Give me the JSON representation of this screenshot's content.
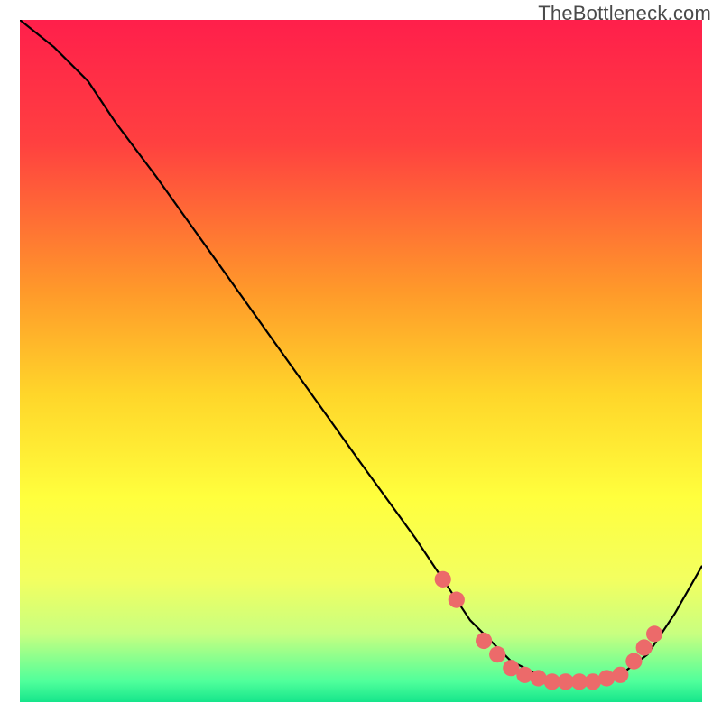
{
  "attribution": "TheBottleneck.com",
  "chart_data": {
    "type": "line",
    "title": "",
    "xlabel": "",
    "ylabel": "",
    "xlim": [
      0,
      100
    ],
    "ylim": [
      0,
      100
    ],
    "background_gradient": {
      "stops": [
        {
          "offset": 0,
          "color": "#ff1f4b"
        },
        {
          "offset": 18,
          "color": "#ff4040"
        },
        {
          "offset": 40,
          "color": "#ff9a2a"
        },
        {
          "offset": 55,
          "color": "#ffd62a"
        },
        {
          "offset": 70,
          "color": "#ffff3d"
        },
        {
          "offset": 82,
          "color": "#f3ff60"
        },
        {
          "offset": 90,
          "color": "#c8ff80"
        },
        {
          "offset": 97,
          "color": "#4fff9b"
        },
        {
          "offset": 100,
          "color": "#15e58b"
        }
      ]
    },
    "series": [
      {
        "name": "bottleneck-curve",
        "color": "#000000",
        "x": [
          0,
          5,
          10,
          14,
          20,
          30,
          40,
          50,
          58,
          62,
          66,
          72,
          78,
          84,
          88,
          92,
          96,
          100
        ],
        "y": [
          100,
          96,
          91,
          85,
          77,
          63,
          49,
          35,
          24,
          18,
          12,
          6,
          3,
          3,
          4,
          7,
          13,
          20
        ]
      }
    ],
    "markers": {
      "name": "highlighted-range",
      "color": "#ec6a6a",
      "radius_pct": 1.2,
      "points": [
        {
          "x": 62,
          "y": 18
        },
        {
          "x": 64,
          "y": 15
        },
        {
          "x": 68,
          "y": 9
        },
        {
          "x": 70,
          "y": 7
        },
        {
          "x": 72,
          "y": 5
        },
        {
          "x": 74,
          "y": 4
        },
        {
          "x": 76,
          "y": 3.5
        },
        {
          "x": 78,
          "y": 3
        },
        {
          "x": 80,
          "y": 3
        },
        {
          "x": 82,
          "y": 3
        },
        {
          "x": 84,
          "y": 3
        },
        {
          "x": 86,
          "y": 3.5
        },
        {
          "x": 88,
          "y": 4
        },
        {
          "x": 90,
          "y": 6
        },
        {
          "x": 91.5,
          "y": 8
        },
        {
          "x": 93,
          "y": 10
        }
      ]
    }
  }
}
